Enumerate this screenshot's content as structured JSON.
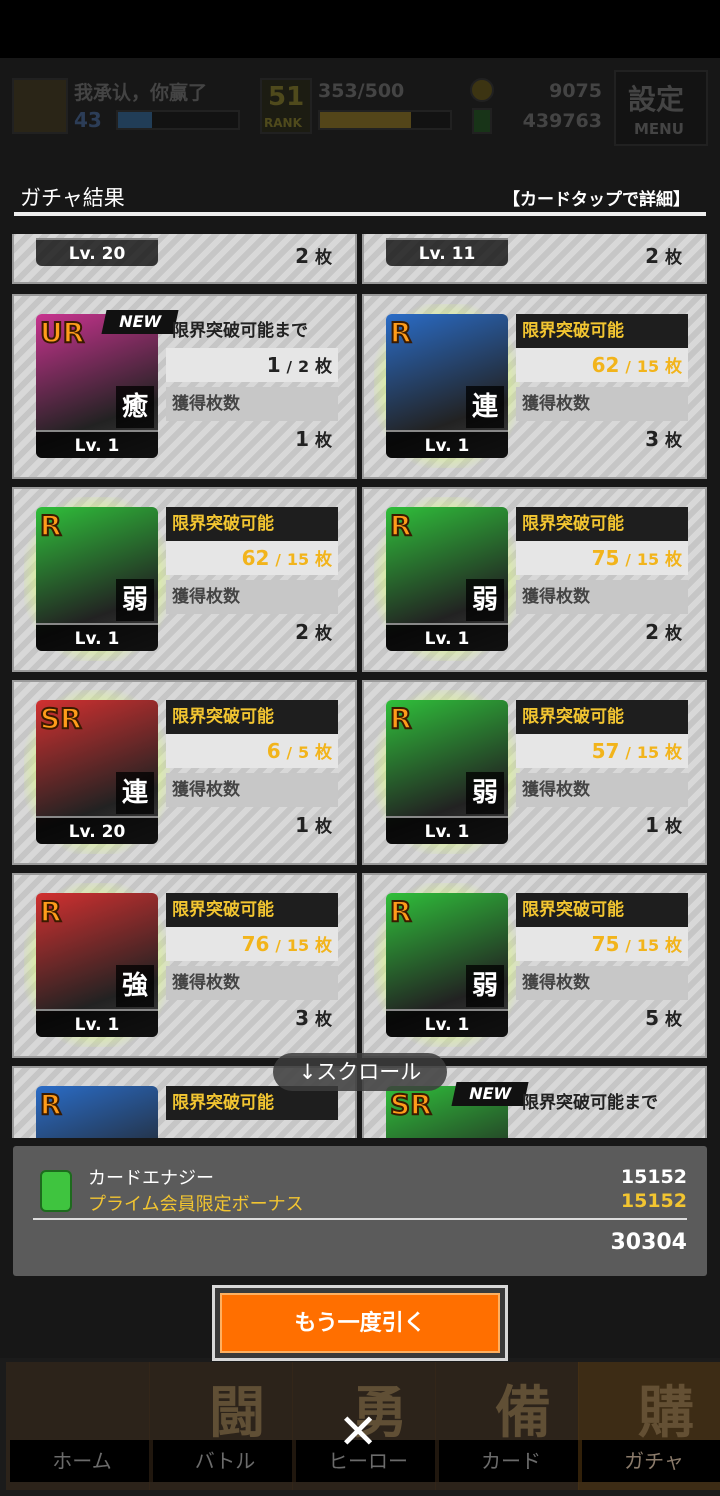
{
  "hud": {
    "player_name": "我承认，你赢了",
    "player_level": "43",
    "rank_number": "51",
    "rank_label": "RANK",
    "stamina": "353/500",
    "coins": "9075",
    "energy": "439763",
    "settings_label": "設定",
    "menu_label": "MENU"
  },
  "panel": {
    "title": "ガチャ結果",
    "hint": "【カードタップで詳細】"
  },
  "labels": {
    "limit_break_ready": "限界突破可能",
    "until_limit_break": "限界突破可能まで",
    "obtained_count": "獲得枚数",
    "unit": "枚",
    "new": "NEW",
    "scroll": "↓スクロール"
  },
  "top_partial": [
    {
      "level": "Lv. 20",
      "count": "2"
    },
    {
      "level": "Lv. 11",
      "count": "2"
    }
  ],
  "cards": [
    {
      "rarity": "UR",
      "attr": "癒",
      "level": "Lv. 1",
      "status": "限界突破可能まで",
      "have": "1",
      "need": "2",
      "obtained": "1",
      "is_new": true,
      "ready": false,
      "color": "#c8338f"
    },
    {
      "rarity": "R",
      "attr": "連",
      "level": "Lv. 1",
      "status": "限界突破可能",
      "have": "62",
      "need": "15",
      "obtained": "3",
      "is_new": false,
      "ready": true,
      "color": "#2a6cc7"
    },
    {
      "rarity": "R",
      "attr": "弱",
      "level": "Lv. 1",
      "status": "限界突破可能",
      "have": "62",
      "need": "15",
      "obtained": "2",
      "is_new": false,
      "ready": true,
      "color": "#2fbf3a"
    },
    {
      "rarity": "R",
      "attr": "弱",
      "level": "Lv. 1",
      "status": "限界突破可能",
      "have": "75",
      "need": "15",
      "obtained": "2",
      "is_new": false,
      "ready": true,
      "color": "#2fbf3a"
    },
    {
      "rarity": "SR",
      "attr": "連",
      "level": "Lv. 20",
      "status": "限界突破可能",
      "have": "6",
      "need": "5",
      "obtained": "1",
      "is_new": false,
      "ready": true,
      "color": "#d13030"
    },
    {
      "rarity": "R",
      "attr": "弱",
      "level": "Lv. 1",
      "status": "限界突破可能",
      "have": "57",
      "need": "15",
      "obtained": "1",
      "is_new": false,
      "ready": true,
      "color": "#2fbf3a"
    },
    {
      "rarity": "R",
      "attr": "強",
      "level": "Lv. 1",
      "status": "限界突破可能",
      "have": "76",
      "need": "15",
      "obtained": "3",
      "is_new": false,
      "ready": true,
      "color": "#d13030"
    },
    {
      "rarity": "R",
      "attr": "弱",
      "level": "Lv. 1",
      "status": "限界突破可能",
      "have": "75",
      "need": "15",
      "obtained": "5",
      "is_new": false,
      "ready": true,
      "color": "#2fbf3a"
    }
  ],
  "bottom_partial": [
    {
      "rarity": "R",
      "status": "限界突破可能",
      "is_new": false,
      "color": "#2a6cc7"
    },
    {
      "rarity": "SR",
      "status": "限界突破可能まで",
      "is_new": true,
      "color": "#2fbf3a"
    }
  ],
  "energy": {
    "label": "カードエナジー",
    "value": "15152",
    "bonus_label": "プライム会員限定ボーナス",
    "bonus_value": "15152",
    "total": "30304"
  },
  "redraw_button": "もう一度引く",
  "nav": [
    {
      "icon": "home-icon",
      "kanji": "",
      "label": "ホーム"
    },
    {
      "icon": "controller-icon",
      "kanji": "闘",
      "label": "バトル"
    },
    {
      "icon": "hero-icon",
      "kanji": "勇",
      "label": "ヒーロー"
    },
    {
      "icon": "cards-icon",
      "kanji": "備",
      "label": "カード"
    },
    {
      "icon": "gacha-icon",
      "kanji": "購",
      "label": "ガチャ"
    }
  ],
  "close_icon": "close-icon"
}
